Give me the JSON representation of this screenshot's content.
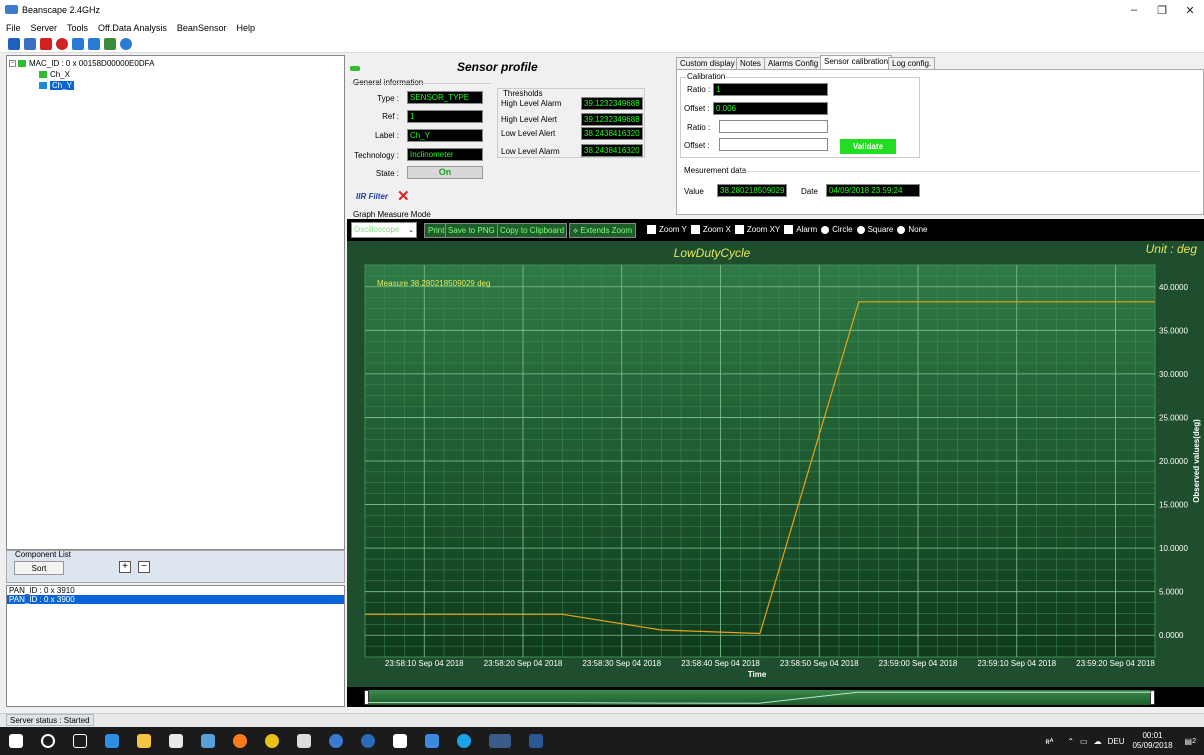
{
  "window": {
    "title": "Beanscape 2.4GHz",
    "min": "–",
    "max": "❐",
    "close": "✕"
  },
  "menu": [
    "File",
    "Server",
    "Tools",
    "Off.Data Analysis",
    "BeanSensor",
    "Help"
  ],
  "toolbar_icon_colors": [
    "#1f5fbf",
    "#3a6fc5",
    "#d32020",
    "#d32020",
    "#2a7ad8",
    "#2a7ad8",
    "#3b8c3b",
    "#2a7ad8"
  ],
  "tree": {
    "root": "MAC_ID : 0 x 00158D00000E0DFA",
    "children": [
      "Ch_X",
      "Ch_Y"
    ],
    "selected": "Ch_Y"
  },
  "component_list": {
    "title": "Component List",
    "sort": "Sort",
    "plus": "+",
    "minus": "−"
  },
  "pan_list": [
    "PAN_ID : 0 x 3910",
    "PAN_ID : 0 x 3900"
  ],
  "status": "Server status : Started",
  "sensor_profile": {
    "title": "Sensor profile",
    "general_info": "General information",
    "fields": [
      {
        "label": "Type :",
        "value": "SENSOR_TYPE"
      },
      {
        "label": "Ref :",
        "value": "1"
      },
      {
        "label": "Label :",
        "value": "Ch_Y"
      },
      {
        "label": "Technology :",
        "value": "Inclinometer"
      }
    ],
    "state_label": "State :",
    "state_value": "On",
    "iir_label": "IIR Filter",
    "thresholds": {
      "title": "Thresholds",
      "rows": [
        {
          "label": "High Level Alarm",
          "value": "39.1232349688"
        },
        {
          "label": "High Level Alert",
          "value": "39.1232349688"
        },
        {
          "label": "Low Level Alert",
          "value": "38.2438416320"
        },
        {
          "label": "Low Level Alarm",
          "value": "38.2438416320"
        }
      ]
    }
  },
  "tabs": [
    "Custom display",
    "Notes",
    "Alarms Config",
    "Sensor calibration",
    "Log config."
  ],
  "active_tab": "Sensor calibration",
  "calibration": {
    "title": "Calibration",
    "ratio_label": "Ratio :",
    "ratio_value": "1",
    "offset_label": "Offset :",
    "offset_value": "0.006",
    "ratio2_label": "Ratio :",
    "offset2_label": "Offset :",
    "validate": "Validate"
  },
  "measurement": {
    "title": "Mesurement data",
    "value_label": "Value",
    "value": "38.280218509029",
    "date_label": "Date",
    "date": "04/09/2018 23:59:24"
  },
  "graph_mode": {
    "title": "Graph Measure Mode",
    "mode": "Oscilloscope",
    "buttons": [
      "Print",
      "Save to PNG",
      "Copy to Clipboard",
      "Extends Zoom"
    ],
    "options": [
      "Zoom Y",
      "Zoom X",
      "Zoom XY",
      "Alarm",
      "Circle",
      "Square",
      "None"
    ]
  },
  "colors": {
    "accent_green": "#22dd22",
    "chart_bg": "#1e4e2d",
    "series": "#e8a317",
    "text_yellow": "#e6e65a"
  },
  "chart_data": {
    "type": "line",
    "title": "LowDutyCycle",
    "unit_label": "Unit : deg",
    "annotation": "Measure  38.280218509029  deg",
    "xlabel": "Time",
    "ylabel": "Observed values(deg)",
    "ylim": [
      -2.5,
      42.5
    ],
    "yticks": [
      "40.0000",
      "35.0000",
      "30.0000",
      "25.0000",
      "20.0000",
      "15.0000",
      "10.0000",
      "5.0000",
      "0.0000"
    ],
    "xticks": [
      "23:58:10 Sep 04 2018",
      "23:58:20 Sep 04 2018",
      "23:58:30 Sep 04 2018",
      "23:58:40 Sep 04 2018",
      "23:58:50 Sep 04 2018",
      "23:59:00 Sep 04 2018",
      "23:59:10 Sep 04 2018",
      "23:59:20 Sep 04 2018"
    ],
    "x_range": [
      "23:58:04",
      "23:59:24"
    ],
    "series": [
      {
        "x": [
          "23:58:04",
          "23:58:24",
          "23:58:34",
          "23:58:44",
          "23:58:54",
          "23:59:24"
        ],
        "values": [
          2.4,
          2.4,
          0.6,
          0.2,
          38.28,
          38.28
        ]
      }
    ]
  },
  "taskbar": {
    "lang": "DEU",
    "time": "00:01",
    "date": "05/09/2018",
    "notif": "2"
  }
}
